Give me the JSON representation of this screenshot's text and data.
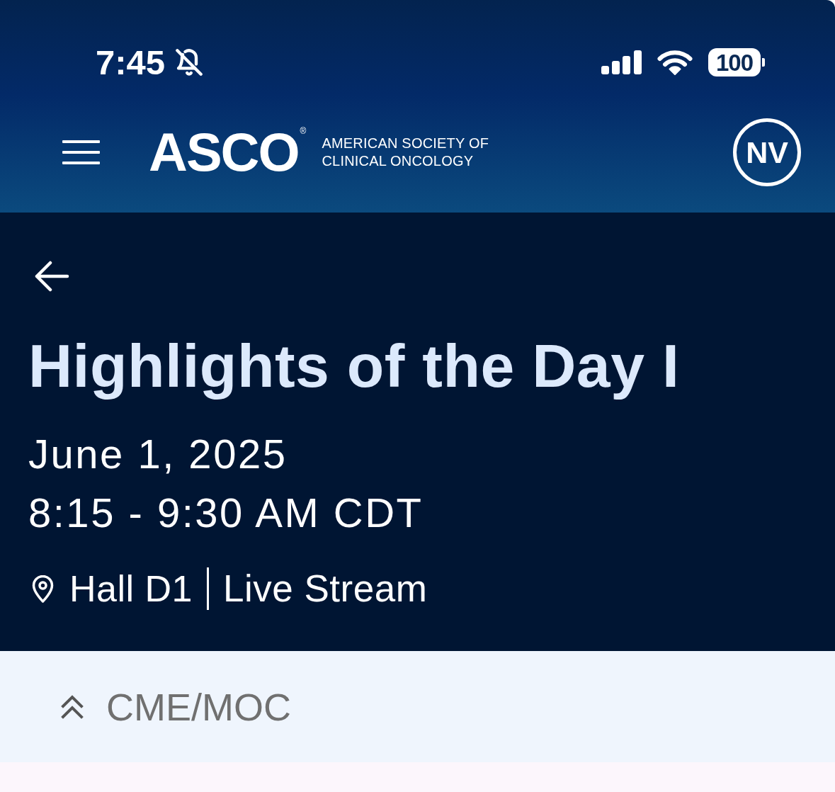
{
  "status_bar": {
    "time": "7:45",
    "silent": true,
    "battery": "100"
  },
  "header": {
    "logo": {
      "wordmark": "ASCO",
      "registered": "®",
      "tagline": [
        "AMERICAN SOCIETY OF",
        "CLINICAL ONCOLOGY"
      ]
    },
    "avatar": {
      "initials": "NV"
    }
  },
  "session": {
    "title": "Highlights of the Day I",
    "date": "June 1, 2025",
    "time": "8:15 - 9:30 AM CDT",
    "location": {
      "room": "Hall D1",
      "format": "Live Stream"
    }
  },
  "credits_section": {
    "label": "CME/MOC"
  }
}
